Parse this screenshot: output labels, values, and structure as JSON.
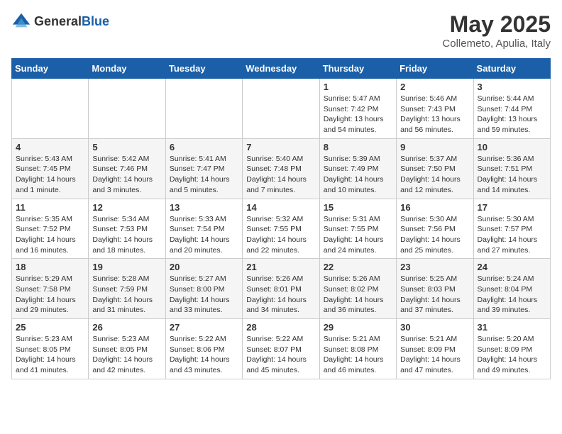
{
  "header": {
    "logo_general": "General",
    "logo_blue": "Blue",
    "title": "May 2025",
    "location": "Collemeto, Apulia, Italy"
  },
  "weekdays": [
    "Sunday",
    "Monday",
    "Tuesday",
    "Wednesday",
    "Thursday",
    "Friday",
    "Saturday"
  ],
  "weeks": [
    [
      {
        "day": "",
        "info": ""
      },
      {
        "day": "",
        "info": ""
      },
      {
        "day": "",
        "info": ""
      },
      {
        "day": "",
        "info": ""
      },
      {
        "day": "1",
        "info": "Sunrise: 5:47 AM\nSunset: 7:42 PM\nDaylight: 13 hours\nand 54 minutes."
      },
      {
        "day": "2",
        "info": "Sunrise: 5:46 AM\nSunset: 7:43 PM\nDaylight: 13 hours\nand 56 minutes."
      },
      {
        "day": "3",
        "info": "Sunrise: 5:44 AM\nSunset: 7:44 PM\nDaylight: 13 hours\nand 59 minutes."
      }
    ],
    [
      {
        "day": "4",
        "info": "Sunrise: 5:43 AM\nSunset: 7:45 PM\nDaylight: 14 hours\nand 1 minute."
      },
      {
        "day": "5",
        "info": "Sunrise: 5:42 AM\nSunset: 7:46 PM\nDaylight: 14 hours\nand 3 minutes."
      },
      {
        "day": "6",
        "info": "Sunrise: 5:41 AM\nSunset: 7:47 PM\nDaylight: 14 hours\nand 5 minutes."
      },
      {
        "day": "7",
        "info": "Sunrise: 5:40 AM\nSunset: 7:48 PM\nDaylight: 14 hours\nand 7 minutes."
      },
      {
        "day": "8",
        "info": "Sunrise: 5:39 AM\nSunset: 7:49 PM\nDaylight: 14 hours\nand 10 minutes."
      },
      {
        "day": "9",
        "info": "Sunrise: 5:37 AM\nSunset: 7:50 PM\nDaylight: 14 hours\nand 12 minutes."
      },
      {
        "day": "10",
        "info": "Sunrise: 5:36 AM\nSunset: 7:51 PM\nDaylight: 14 hours\nand 14 minutes."
      }
    ],
    [
      {
        "day": "11",
        "info": "Sunrise: 5:35 AM\nSunset: 7:52 PM\nDaylight: 14 hours\nand 16 minutes."
      },
      {
        "day": "12",
        "info": "Sunrise: 5:34 AM\nSunset: 7:53 PM\nDaylight: 14 hours\nand 18 minutes."
      },
      {
        "day": "13",
        "info": "Sunrise: 5:33 AM\nSunset: 7:54 PM\nDaylight: 14 hours\nand 20 minutes."
      },
      {
        "day": "14",
        "info": "Sunrise: 5:32 AM\nSunset: 7:55 PM\nDaylight: 14 hours\nand 22 minutes."
      },
      {
        "day": "15",
        "info": "Sunrise: 5:31 AM\nSunset: 7:55 PM\nDaylight: 14 hours\nand 24 minutes."
      },
      {
        "day": "16",
        "info": "Sunrise: 5:30 AM\nSunset: 7:56 PM\nDaylight: 14 hours\nand 25 minutes."
      },
      {
        "day": "17",
        "info": "Sunrise: 5:30 AM\nSunset: 7:57 PM\nDaylight: 14 hours\nand 27 minutes."
      }
    ],
    [
      {
        "day": "18",
        "info": "Sunrise: 5:29 AM\nSunset: 7:58 PM\nDaylight: 14 hours\nand 29 minutes."
      },
      {
        "day": "19",
        "info": "Sunrise: 5:28 AM\nSunset: 7:59 PM\nDaylight: 14 hours\nand 31 minutes."
      },
      {
        "day": "20",
        "info": "Sunrise: 5:27 AM\nSunset: 8:00 PM\nDaylight: 14 hours\nand 33 minutes."
      },
      {
        "day": "21",
        "info": "Sunrise: 5:26 AM\nSunset: 8:01 PM\nDaylight: 14 hours\nand 34 minutes."
      },
      {
        "day": "22",
        "info": "Sunrise: 5:26 AM\nSunset: 8:02 PM\nDaylight: 14 hours\nand 36 minutes."
      },
      {
        "day": "23",
        "info": "Sunrise: 5:25 AM\nSunset: 8:03 PM\nDaylight: 14 hours\nand 37 minutes."
      },
      {
        "day": "24",
        "info": "Sunrise: 5:24 AM\nSunset: 8:04 PM\nDaylight: 14 hours\nand 39 minutes."
      }
    ],
    [
      {
        "day": "25",
        "info": "Sunrise: 5:23 AM\nSunset: 8:05 PM\nDaylight: 14 hours\nand 41 minutes."
      },
      {
        "day": "26",
        "info": "Sunrise: 5:23 AM\nSunset: 8:05 PM\nDaylight: 14 hours\nand 42 minutes."
      },
      {
        "day": "27",
        "info": "Sunrise: 5:22 AM\nSunset: 8:06 PM\nDaylight: 14 hours\nand 43 minutes."
      },
      {
        "day": "28",
        "info": "Sunrise: 5:22 AM\nSunset: 8:07 PM\nDaylight: 14 hours\nand 45 minutes."
      },
      {
        "day": "29",
        "info": "Sunrise: 5:21 AM\nSunset: 8:08 PM\nDaylight: 14 hours\nand 46 minutes."
      },
      {
        "day": "30",
        "info": "Sunrise: 5:21 AM\nSunset: 8:09 PM\nDaylight: 14 hours\nand 47 minutes."
      },
      {
        "day": "31",
        "info": "Sunrise: 5:20 AM\nSunset: 8:09 PM\nDaylight: 14 hours\nand 49 minutes."
      }
    ]
  ]
}
